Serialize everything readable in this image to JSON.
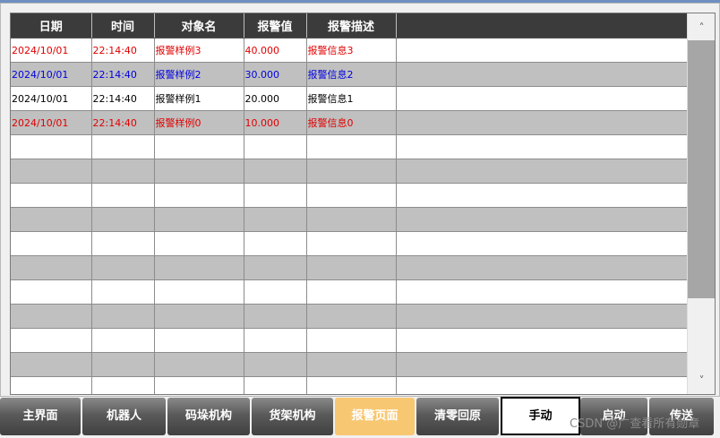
{
  "table": {
    "headers": [
      "日期",
      "时间",
      "对象名",
      "报警值",
      "报警描述",
      ""
    ],
    "rows": [
      {
        "color": "#e00000",
        "cells": [
          "2024/10/01",
          "22:14:40",
          "报警样例3",
          "40.000",
          "报警信息3",
          ""
        ]
      },
      {
        "color": "#0000e0",
        "cells": [
          "2024/10/01",
          "22:14:40",
          "报警样例2",
          "30.000",
          "报警信息2",
          ""
        ]
      },
      {
        "color": "#000000",
        "cells": [
          "2024/10/01",
          "22:14:40",
          "报警样例1",
          "20.000",
          "报警信息1",
          ""
        ]
      },
      {
        "color": "#e00000",
        "cells": [
          "2024/10/01",
          "22:14:40",
          "报警样例0",
          "10.000",
          "报警信息0",
          ""
        ]
      },
      {
        "color": "#000000",
        "cells": [
          "",
          "",
          "",
          "",
          "",
          ""
        ]
      },
      {
        "color": "#000000",
        "cells": [
          "",
          "",
          "",
          "",
          "",
          ""
        ]
      },
      {
        "color": "#000000",
        "cells": [
          "",
          "",
          "",
          "",
          "",
          ""
        ]
      },
      {
        "color": "#000000",
        "cells": [
          "",
          "",
          "",
          "",
          "",
          ""
        ]
      },
      {
        "color": "#000000",
        "cells": [
          "",
          "",
          "",
          "",
          "",
          ""
        ]
      },
      {
        "color": "#000000",
        "cells": [
          "",
          "",
          "",
          "",
          "",
          ""
        ]
      },
      {
        "color": "#000000",
        "cells": [
          "",
          "",
          "",
          "",
          "",
          ""
        ]
      },
      {
        "color": "#000000",
        "cells": [
          "",
          "",
          "",
          "",
          "",
          ""
        ]
      },
      {
        "color": "#000000",
        "cells": [
          "",
          "",
          "",
          "",
          "",
          ""
        ]
      },
      {
        "color": "#000000",
        "cells": [
          "",
          "",
          "",
          "",
          "",
          ""
        ]
      },
      {
        "color": "#000000",
        "cells": [
          "",
          "",
          "",
          "",
          "",
          ""
        ]
      }
    ]
  },
  "scrollbar": {
    "up_icon": "chevron-up-icon",
    "down_icon": "chevron-down-icon",
    "up_glyph": "˄",
    "down_glyph": "˅"
  },
  "nav": {
    "buttons": [
      {
        "label": "主界面",
        "state": "normal"
      },
      {
        "label": "机器人",
        "state": "normal"
      },
      {
        "label": "码垛机构",
        "state": "normal"
      },
      {
        "label": "货架机构",
        "state": "normal"
      },
      {
        "label": "报警页面",
        "state": "active"
      },
      {
        "label": "清零回原",
        "state": "normal"
      },
      {
        "label": "手动",
        "state": "manual"
      },
      {
        "label": "启动",
        "state": "normal"
      },
      {
        "label": "传送",
        "state": "normal"
      }
    ]
  },
  "watermark": "CSDN @广查看所有勋章",
  "colors": {
    "header_bg": "#3b3b3b",
    "row_alt": "#c0c0c0",
    "active_tab": "#f8c772",
    "alarm_red": "#e00000",
    "alarm_blue": "#0000e0"
  }
}
